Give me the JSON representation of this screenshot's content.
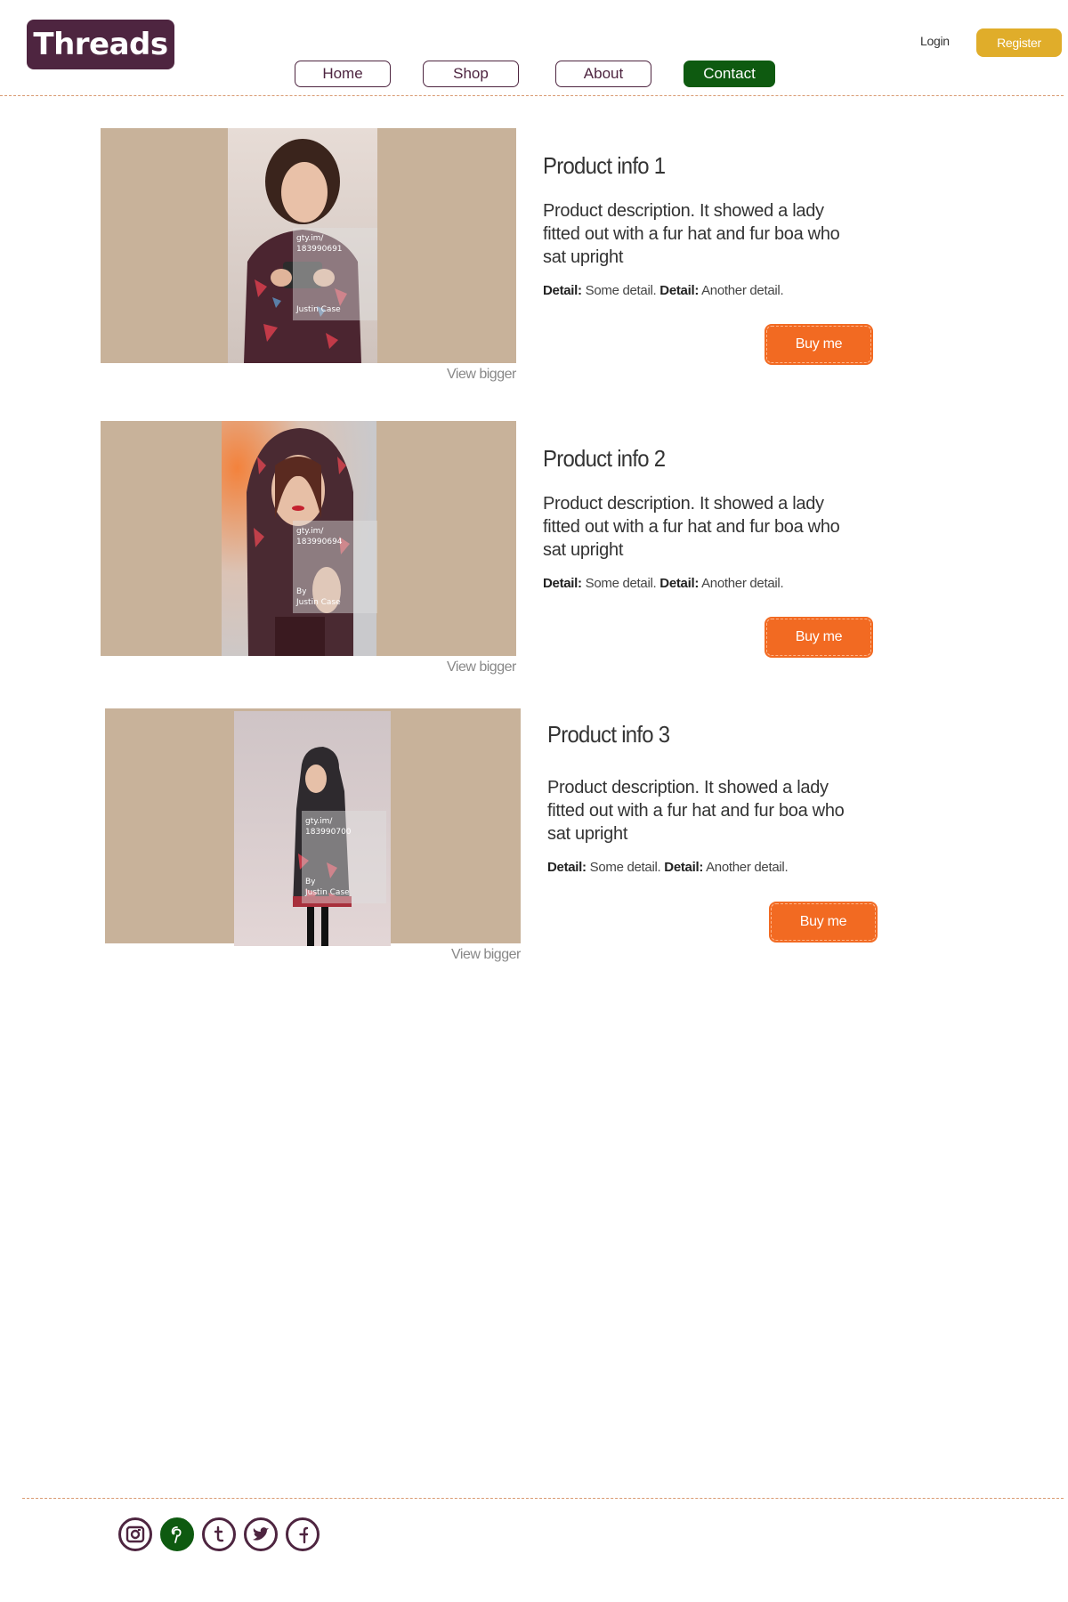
{
  "header": {
    "logo": "Threads",
    "nav": [
      "Home",
      "Shop",
      "About",
      "Contact"
    ],
    "active_nav": "Contact",
    "login": "Login",
    "register": "Register"
  },
  "colors": {
    "brand": "#4e2540",
    "active_nav": "#0e5a10",
    "register": "#e0ad2a",
    "buy_button": "#f26a22",
    "image_bg": "#c8b29a",
    "divider": "#d99a72"
  },
  "products": [
    {
      "title": "Product info 1",
      "description": "Product description. It showed a lady fitted out with a fur hat and fur boa who sat upright",
      "detail_label_1": "Detail:",
      "detail_value_1": "Some detail.",
      "detail_label_2": "Detail:",
      "detail_value_2": "Another detail.",
      "buy": "Buy me",
      "view": "View bigger",
      "watermark_url": "gty.im/",
      "watermark_id": "183990691",
      "watermark_by": "Justin Case"
    },
    {
      "title": "Product info 2",
      "description": "Product description. It showed a lady fitted out with a fur hat and fur boa who sat upright",
      "detail_label_1": "Detail:",
      "detail_value_1": "Some detail.",
      "detail_label_2": "Detail:",
      "detail_value_2": "Another detail.",
      "buy": "Buy me",
      "view": "View bigger",
      "watermark_url": "gty.im/",
      "watermark_id": "183990694",
      "watermark_by_prefix": "By",
      "watermark_by": "Justin Case"
    },
    {
      "title": "Product info 3",
      "description": "Product description. It showed a lady fitted out with a fur hat and fur boa who sat upright",
      "detail_label_1": "Detail:",
      "detail_value_1": "Some detail.",
      "detail_label_2": "Detail:",
      "detail_value_2": "Another detail.",
      "buy": "Buy me",
      "view": "View bigger",
      "watermark_url": "gty.im/",
      "watermark_id": "183990700",
      "watermark_by_prefix": "By",
      "watermark_by": "Justin Case"
    }
  ],
  "footer": {
    "social_icons": [
      "instagram-icon",
      "pinterest-icon",
      "tumblr-icon",
      "twitter-icon",
      "facebook-icon"
    ],
    "active_social": "pinterest-icon"
  }
}
